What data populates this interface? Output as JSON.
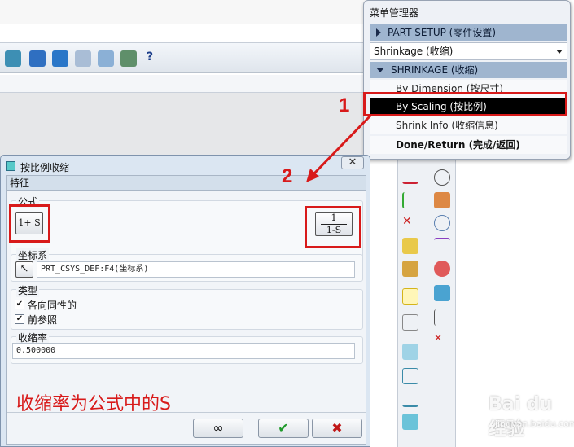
{
  "menu": {
    "title": "菜单管理器",
    "part_setup": "PART SETUP (零件设置)",
    "dropdown_value": "Shrinkage (收缩)",
    "shrinkage_header": "SHRINKAGE (收缩)",
    "items": {
      "by_dimension": "By Dimension (按尺寸)",
      "by_scaling": "By Scaling (按比例)",
      "shrink_info": "Shrink Info (收缩信息)",
      "done_return": "Done/Return (完成/返回)"
    }
  },
  "dialog": {
    "title": "按比例收缩",
    "close_glyph": "✕",
    "tab_label": "特征",
    "formula": {
      "label": "公式",
      "option1": "1+ S",
      "option2_num": "1",
      "option2_den": "1-S"
    },
    "coord": {
      "label": "坐标系",
      "value": "PRT_CSYS_DEF:F4(坐标系)"
    },
    "type": {
      "label": "类型",
      "isotropic": "各向同性的",
      "forward_ref": "前参照"
    },
    "ratio": {
      "label": "收缩率",
      "value": "0.500000"
    },
    "note": "收缩率为公式中的S",
    "preview_glyph": "∞",
    "ok_glyph": "✔",
    "cancel_glyph": "✖"
  },
  "annotations": {
    "step1": "1",
    "step2": "2"
  },
  "watermark": {
    "text": "Bai du 经验",
    "sub": "jingyan.baidu.com"
  },
  "colors": {
    "annotation_red": "#d81a1a",
    "menu_header": "#9fb5cf",
    "selected_row": "#000000"
  }
}
